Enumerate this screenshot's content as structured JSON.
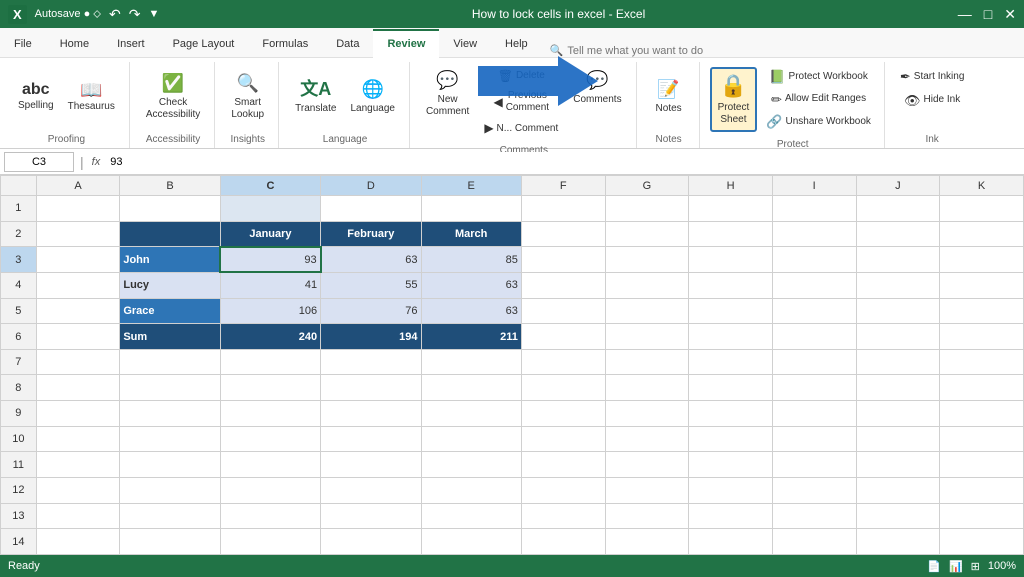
{
  "titleBar": {
    "appName": "Autosave",
    "filename": "How to lock cells in excel - Excel",
    "windowControls": [
      "—",
      "□",
      "✕"
    ]
  },
  "ribbon": {
    "tabs": [
      "File",
      "Home",
      "Insert",
      "Page Layout",
      "Formulas",
      "Data",
      "Review",
      "View",
      "Help"
    ],
    "activeTab": "Review",
    "groups": [
      {
        "name": "Proofing",
        "buttons": [
          {
            "id": "spelling",
            "icon": "abc",
            "label": "Spelling"
          },
          {
            "id": "thesaurus",
            "icon": "📖",
            "label": "Thesaurus"
          }
        ]
      },
      {
        "name": "Accessibility",
        "buttons": [
          {
            "id": "check-accessibility",
            "icon": "✓",
            "label": "Check Accessibility"
          }
        ]
      },
      {
        "name": "Insights",
        "buttons": [
          {
            "id": "smart-lookup",
            "icon": "🔍",
            "label": "Smart Lookup"
          }
        ]
      },
      {
        "name": "Language",
        "buttons": [
          {
            "id": "translate",
            "icon": "文A",
            "label": "Translate"
          },
          {
            "id": "language",
            "icon": "🌐",
            "label": "Language"
          }
        ]
      },
      {
        "name": "Comments",
        "buttons": [
          {
            "id": "new-comment",
            "icon": "💬",
            "label": "New Comment"
          },
          {
            "id": "delete-comment",
            "icon": "🗑",
            "label": "Delete"
          },
          {
            "id": "prev-comment",
            "icon": "◀",
            "label": "Previous Comment"
          },
          {
            "id": "next-comment",
            "icon": "▶",
            "label": "Next Comment"
          },
          {
            "id": "show-comments",
            "icon": "💬",
            "label": "Comments"
          }
        ]
      },
      {
        "name": "Notes",
        "buttons": [
          {
            "id": "notes",
            "icon": "📝",
            "label": "Notes"
          }
        ]
      },
      {
        "name": "Protect",
        "buttons": [
          {
            "id": "protect-sheet",
            "icon": "🔒",
            "label": "Protect Sheet",
            "highlighted": true
          },
          {
            "id": "protect-workbook",
            "icon": "📗",
            "label": "Protect Workbook"
          },
          {
            "id": "allow-edit-ranges",
            "icon": "✏",
            "label": "Allow Edit Ranges"
          },
          {
            "id": "unshare-workbook",
            "icon": "🔗",
            "label": "Unshare Workbook"
          }
        ]
      },
      {
        "name": "Ink",
        "buttons": [
          {
            "id": "start-inking",
            "icon": "✒",
            "label": "Start Inking"
          },
          {
            "id": "hide-ink",
            "icon": "👁",
            "label": "Hide Ink"
          }
        ]
      }
    ]
  },
  "formulaBar": {
    "nameBox": "C3",
    "formula": "93"
  },
  "spreadsheet": {
    "columns": [
      "",
      "A",
      "B",
      "C",
      "D",
      "E",
      "F",
      "G",
      "H",
      "I",
      "J",
      "K"
    ],
    "rows": [
      {
        "num": 1,
        "cells": [
          "",
          "",
          "",
          "",
          "",
          "",
          "",
          "",
          "",
          "",
          "",
          ""
        ]
      },
      {
        "num": 2,
        "cells": [
          "",
          "",
          "",
          "January",
          "February",
          "March",
          "",
          "",
          "",
          "",
          "",
          ""
        ]
      },
      {
        "num": 3,
        "cells": [
          "",
          "",
          "John",
          "93",
          "63",
          "85",
          "",
          "",
          "",
          "",
          "",
          ""
        ]
      },
      {
        "num": 4,
        "cells": [
          "",
          "",
          "Lucy",
          "41",
          "55",
          "63",
          "",
          "",
          "",
          "",
          "",
          ""
        ]
      },
      {
        "num": 5,
        "cells": [
          "",
          "",
          "Grace",
          "106",
          "76",
          "63",
          "",
          "",
          "",
          "",
          "",
          ""
        ]
      },
      {
        "num": 6,
        "cells": [
          "",
          "",
          "Sum",
          "240",
          "194",
          "211",
          "",
          "",
          "",
          "",
          "",
          ""
        ]
      },
      {
        "num": 7,
        "cells": [
          "",
          "",
          "",
          "",
          "",
          "",
          "",
          "",
          "",
          "",
          "",
          ""
        ]
      },
      {
        "num": 8,
        "cells": [
          "",
          "",
          "",
          "",
          "",
          "",
          "",
          "",
          "",
          "",
          "",
          ""
        ]
      },
      {
        "num": 9,
        "cells": [
          "",
          "",
          "",
          "",
          "",
          "",
          "",
          "",
          "",
          "",
          "",
          ""
        ]
      },
      {
        "num": 10,
        "cells": [
          "",
          "",
          "",
          "",
          "",
          "",
          "",
          "",
          "",
          "",
          "",
          ""
        ]
      },
      {
        "num": 11,
        "cells": [
          "",
          "",
          "",
          "",
          "",
          "",
          "",
          "",
          "",
          "",
          "",
          ""
        ]
      },
      {
        "num": 12,
        "cells": [
          "",
          "",
          "",
          "",
          "",
          "",
          "",
          "",
          "",
          "",
          "",
          ""
        ]
      },
      {
        "num": 13,
        "cells": [
          "",
          "",
          "",
          "",
          "",
          "",
          "",
          "",
          "",
          "",
          "",
          ""
        ]
      },
      {
        "num": 14,
        "cells": [
          "",
          "",
          "",
          "",
          "",
          "",
          "",
          "",
          "",
          "",
          "",
          ""
        ]
      }
    ]
  },
  "statusBar": {
    "mode": "Ready",
    "zoomLevel": "100%",
    "viewControls": [
      "📄",
      "📊",
      "⊞"
    ]
  },
  "searchBar": {
    "placeholder": "Tell me what you want to do"
  }
}
